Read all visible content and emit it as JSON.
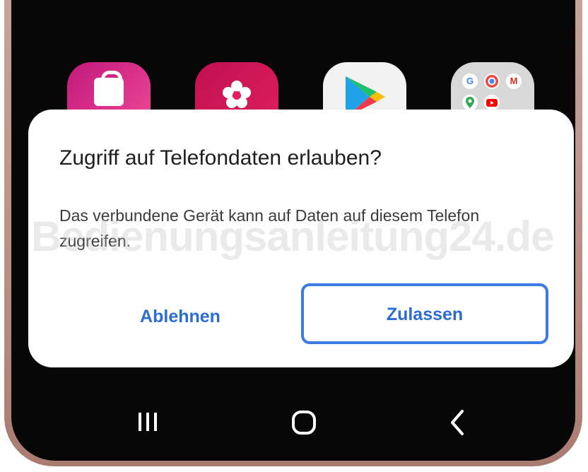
{
  "dialog": {
    "title": "Zugriff auf Telefondaten erlauben?",
    "message": "Das verbundene Gerät kann auf Daten auf diesem Telefon zugreifen.",
    "deny_label": "Ablehnen",
    "allow_label": "Zulassen"
  },
  "watermark": {
    "text": "Bedienungsanleitung24.de"
  },
  "home_screen": {
    "apps": [
      {
        "icon": "galaxy-store-icon"
      },
      {
        "icon": "gallery-icon"
      },
      {
        "icon": "play-store-icon"
      },
      {
        "icon": "google-folder-icon"
      }
    ],
    "folder_minis": [
      "G",
      "M"
    ]
  },
  "navigation_bar": {
    "buttons": [
      "recents-icon",
      "home-icon",
      "back-icon"
    ]
  },
  "colors": {
    "accent": "#2c6ed0",
    "allow_border": "#3b7be3",
    "screen_bg": "#070707",
    "frame": "#c9a59a"
  }
}
